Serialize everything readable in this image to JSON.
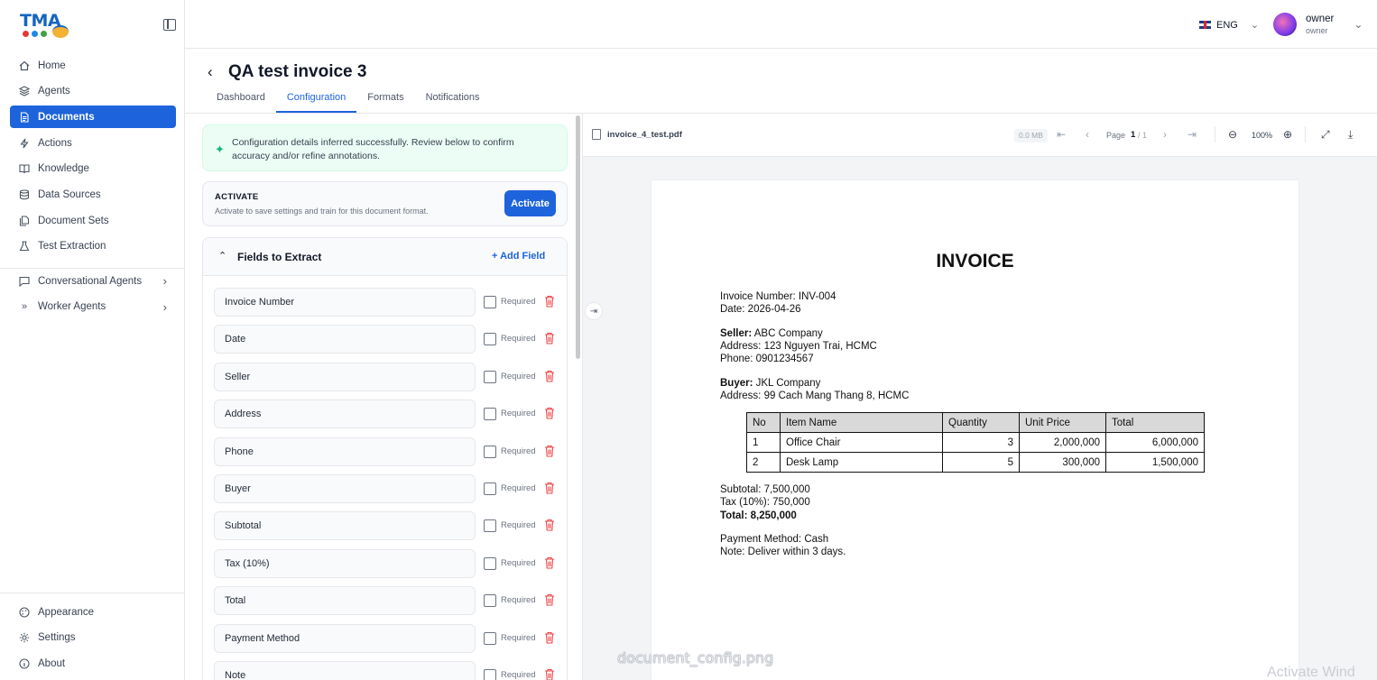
{
  "brand": {
    "logo_text": "TMA",
    "dot_colors": [
      "#e53935",
      "#1e88e5",
      "#43a047"
    ]
  },
  "sidebar": {
    "items": [
      {
        "label": "Home",
        "icon": "home-icon"
      },
      {
        "label": "Agents",
        "icon": "layers-icon"
      },
      {
        "label": "Documents",
        "icon": "document-icon",
        "active": true
      },
      {
        "label": "Actions",
        "icon": "bolt-icon"
      },
      {
        "label": "Knowledge",
        "icon": "book-icon"
      },
      {
        "label": "Data Sources",
        "icon": "database-icon"
      },
      {
        "label": "Document Sets",
        "icon": "files-icon"
      },
      {
        "label": "Test Extraction",
        "icon": "flask-icon"
      }
    ],
    "groups": [
      {
        "label": "Conversational Agents",
        "icon": "chat-icon"
      },
      {
        "label": "Worker Agents",
        "icon": "double-chevron-icon"
      }
    ],
    "bottom": [
      {
        "label": "Appearance",
        "icon": "palette-icon"
      },
      {
        "label": "Settings",
        "icon": "gear-icon"
      },
      {
        "label": "About",
        "icon": "info-icon"
      }
    ]
  },
  "topbar": {
    "language": "ENG",
    "user_name": "owner",
    "user_role": "owner"
  },
  "page": {
    "title": "QA test invoice 3",
    "tabs": [
      {
        "label": "Dashboard"
      },
      {
        "label": "Configuration",
        "active": true
      },
      {
        "label": "Formats"
      },
      {
        "label": "Notifications"
      }
    ]
  },
  "config": {
    "success_message": "Configuration details inferred successfully. Review below to confirm accuracy and/or refine annotations.",
    "activate_title": "ACTIVATE",
    "activate_subtitle": "Activate to save settings and train for this document format.",
    "activate_button": "Activate",
    "fields_title": "Fields to Extract",
    "add_field": "+ Add Field",
    "required_label": "Required",
    "fields": [
      "Invoice Number",
      "Date",
      "Seller",
      "Address",
      "Phone",
      "Buyer",
      "Subtotal",
      "Tax (10%)",
      "Total",
      "Payment Method",
      "Note"
    ]
  },
  "viewer": {
    "file_name": "invoice_4_test.pdf",
    "file_size": "0.0 MB",
    "page_label": "Page",
    "page_current": "1",
    "page_total": "/ 1",
    "zoom": "100%"
  },
  "invoice": {
    "title": "INVOICE",
    "invoice_number": "Invoice Number: INV-004",
    "date": "Date: 2026-04-26",
    "seller_label": "Seller:",
    "seller_name": " ABC Company",
    "seller_address": "Address: 123 Nguyen Trai, HCMC",
    "seller_phone": "Phone: 0901234567",
    "buyer_label": "Buyer:",
    "buyer_name": " JKL Company",
    "buyer_address": "Address: 99 Cach Mang Thang 8, HCMC",
    "table_headers": [
      "No",
      "Item Name",
      "Quantity",
      "Unit Price",
      "Total"
    ],
    "table_rows": [
      [
        "1",
        "Office Chair",
        "3",
        "2,000,000",
        "6,000,000"
      ],
      [
        "2",
        "Desk Lamp",
        "5",
        "300,000",
        "1,500,000"
      ]
    ],
    "subtotal": "Subtotal: 7,500,000",
    "tax": "Tax (10%): 750,000",
    "total": "Total: 8,250,000",
    "payment": "Payment Method: Cash",
    "note": "Note: Deliver within 3 days."
  },
  "overlays": {
    "filename_caption": "document_config.png",
    "windows_watermark": "Activate Wind"
  },
  "colors": {
    "accent": "#1d63dc",
    "success_bg": "#ecfdf5",
    "delete": "#ef4444"
  }
}
